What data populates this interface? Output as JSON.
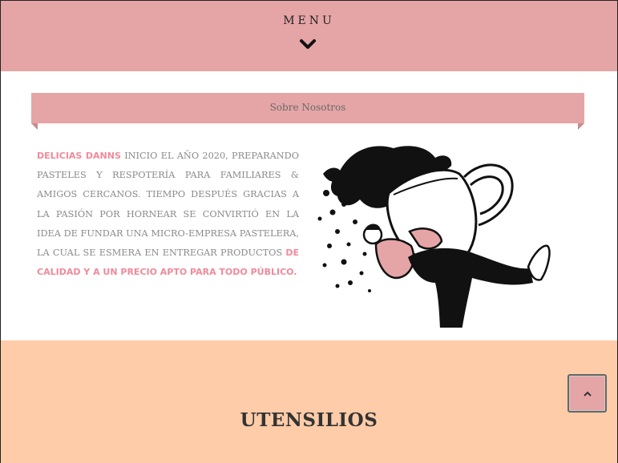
{
  "header": {
    "menu_label": "MENU",
    "menu_icon": "chevron-down-icon"
  },
  "about": {
    "ribbon_title": "Sobre Nosotros",
    "brand": "DELICIAS DANNS",
    "text_part1": " inicio el año 2020, preparando pasteles y respotería para familiares & amigos cercanos. Tiempo después gracias a la pasión por hornear se convirtió en la idea de fundar una micro-empresa pastelera, la cual se esmera en entregar productos ",
    "highlight": "de calidad y a un precio apto para todo público."
  },
  "utensils": {
    "title": "UTENSILIOS"
  },
  "scroll_top": {
    "icon": "chevron-up-icon"
  },
  "colors": {
    "pink": "#e5a5a6",
    "peach": "#fecca8",
    "accent": "#f08a9a"
  }
}
